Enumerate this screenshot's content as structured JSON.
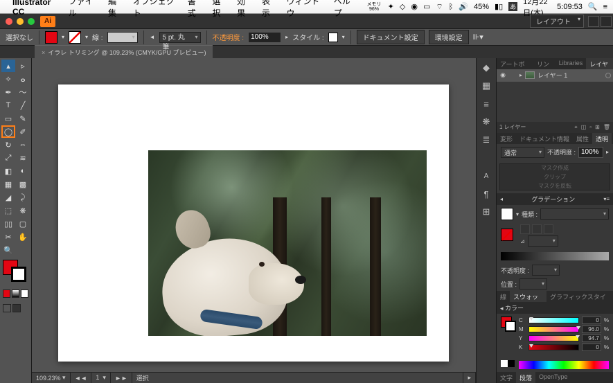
{
  "menubar": {
    "app": "Illustrator CC",
    "items": [
      "ファイル",
      "編集",
      "オブジェクト",
      "書式",
      "選択",
      "効果",
      "表示",
      "ウィンドウ",
      "ヘルプ"
    ],
    "mem": "メモリ\n96%",
    "battery": "45%",
    "date": "12月22日(木)",
    "time": "5:09:53"
  },
  "title": {
    "layout_label": "レイアウト"
  },
  "control": {
    "selection": "選択なし",
    "stroke_label": "線 :",
    "stroke_weight": "5 pt. 丸筆",
    "opacity_label": "不透明度 :",
    "opacity_val": "100%",
    "style_label": "スタイル :",
    "doc_setup": "ドキュメント設定",
    "prefs": "環境設定"
  },
  "doc_tab": {
    "name": "イラレ トリミング @ 109.23% (CMYK/GPU プレビュー)"
  },
  "status": {
    "zoom": "109.23%",
    "mode": "選択"
  },
  "panels": {
    "tabset1": [
      "アートボード",
      "リンク",
      "Libraries",
      "レイヤー"
    ],
    "layer1": "レイヤー 1",
    "layer_count": "1 レイヤー",
    "tabset2": [
      "変形",
      "ドキュメント情報",
      "属性",
      "透明"
    ],
    "blend": "通常",
    "opacity_lbl": "不透明度 :",
    "opacity_val": "100%",
    "mask_make": "マスク作成",
    "mask_clip": "クリップ",
    "mask_invert": "マスクを反転",
    "gradient_title": "グラデーション",
    "grad_type_lbl": "種類 :",
    "grad_opacity_lbl": "不透明度 :",
    "grad_pos_lbl": "位置 :",
    "tabset3": [
      "線",
      "スウォッチ",
      "グラフィックスタイル"
    ],
    "color_title": "カラー",
    "cmyk": {
      "c": {
        "lbl": "C",
        "val": "0"
      },
      "m": {
        "lbl": "M",
        "val": "96.0"
      },
      "y": {
        "lbl": "Y",
        "val": "94.7"
      },
      "k": {
        "lbl": "K",
        "val": "0"
      }
    },
    "tabset4": [
      "文字",
      "段落",
      "OpenType"
    ]
  }
}
